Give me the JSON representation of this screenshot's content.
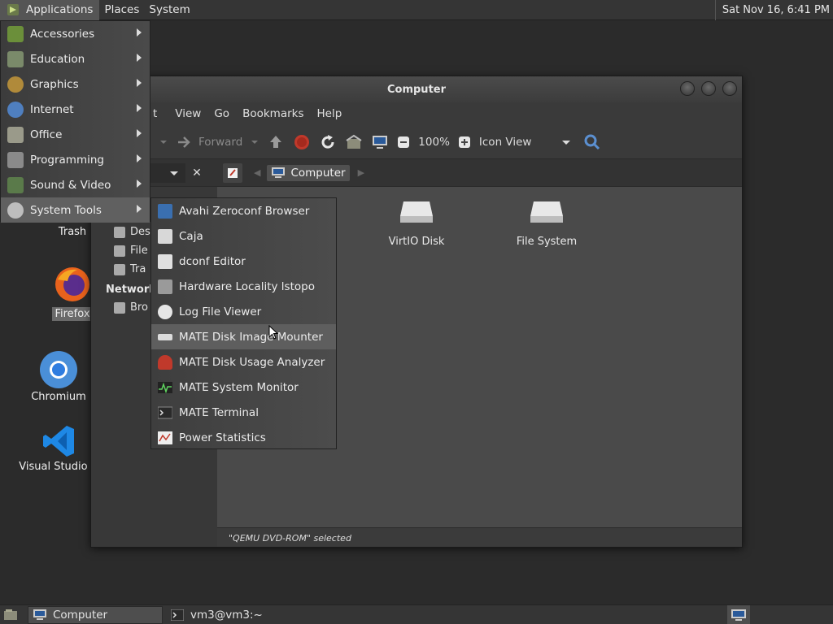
{
  "top_panel": {
    "menus": [
      "Applications",
      "Places",
      "System"
    ],
    "clock": "Sat Nov 16,  6:41 PM"
  },
  "desktop": {
    "icons": [
      {
        "label": "Trash",
        "icon": "trash-icon"
      },
      {
        "label": "Firefox",
        "icon": "firefox-icon"
      },
      {
        "label": "Chromium",
        "icon": "chromium-icon"
      },
      {
        "label": "Visual Studio Co",
        "icon": "vscode-icon"
      }
    ]
  },
  "file_manager": {
    "title": "Computer",
    "menu_partial": "t",
    "menus": [
      "View",
      "Go",
      "Bookmarks",
      "Help"
    ],
    "toolbar": {
      "forward_label": "Forward",
      "zoom": "100%",
      "view_mode": "Icon View"
    },
    "path_button": "Computer",
    "sidebar": {
      "items": [
        "Des",
        "File",
        "Tra"
      ],
      "network_heading": "Network",
      "network_items": [
        "Bro"
      ]
    },
    "drives": [
      {
        "label": "VirtIO Disk",
        "icon": "disk-icon"
      },
      {
        "label": "File System",
        "icon": "disk-icon"
      }
    ],
    "status": "\"QEMU DVD-ROM\" selected"
  },
  "apps_menu": {
    "items": [
      {
        "label": "Accessories",
        "icon": "accessories-icon"
      },
      {
        "label": "Education",
        "icon": "education-icon"
      },
      {
        "label": "Graphics",
        "icon": "graphics-icon"
      },
      {
        "label": "Internet",
        "icon": "internet-icon"
      },
      {
        "label": "Office",
        "icon": "office-icon"
      },
      {
        "label": "Programming",
        "icon": "programming-icon"
      },
      {
        "label": "Sound & Video",
        "icon": "sound-video-icon"
      },
      {
        "label": "System Tools",
        "icon": "system-tools-icon"
      }
    ]
  },
  "system_tools_menu": {
    "items": [
      {
        "label": "Avahi Zeroconf Browser",
        "icon": "avahi-icon"
      },
      {
        "label": "Caja",
        "icon": "caja-icon"
      },
      {
        "label": "dconf Editor",
        "icon": "dconf-icon"
      },
      {
        "label": "Hardware Locality lstopo",
        "icon": "hardware-icon"
      },
      {
        "label": "Log File Viewer",
        "icon": "log-viewer-icon"
      },
      {
        "label": "MATE Disk Image Mounter",
        "icon": "disk-mounter-icon"
      },
      {
        "label": "MATE Disk Usage Analyzer",
        "icon": "disk-usage-icon"
      },
      {
        "label": "MATE System Monitor",
        "icon": "system-monitor-icon"
      },
      {
        "label": "MATE Terminal",
        "icon": "terminal-icon"
      },
      {
        "label": "Power Statistics",
        "icon": "power-stats-icon"
      }
    ]
  },
  "taskbar": {
    "tasks": [
      "Computer",
      "vm3@vm3:~"
    ]
  },
  "colors": {
    "panel": "#353535",
    "menu_active": "#606060",
    "content_bg": "#4a4a4a"
  }
}
